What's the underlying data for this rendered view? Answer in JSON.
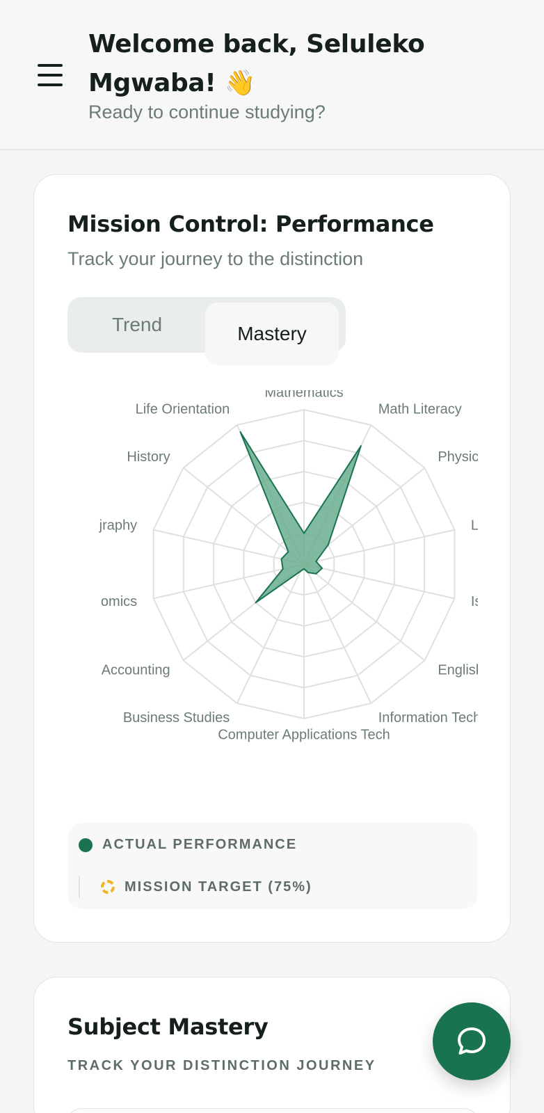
{
  "header": {
    "welcome": "Welcome back, Seluleko Mgwaba!",
    "wave": "👋",
    "subtitle": "Ready to continue studying?"
  },
  "performance_card": {
    "title": "Mission Control: Performance",
    "subtitle": "Track your journey to the distinction",
    "tabs": [
      {
        "label": "Trend",
        "selected": false
      },
      {
        "label": "Mastery",
        "selected": true
      }
    ],
    "legend": {
      "actual": "ACTUAL PERFORMANCE",
      "target": "MISSION TARGET (75%)"
    }
  },
  "chart_data": {
    "type": "radar",
    "categories": [
      "Mathematics",
      "Math Literacy",
      "Physical Sc",
      "Life Sc",
      "IsiZulu",
      "English Hor",
      "Information Technol",
      "Computer Applications Tech",
      "Business Studies",
      "Accounting",
      "omics",
      "jraphy",
      "History",
      "Life Orientation"
    ],
    "rlim": [
      0,
      100
    ],
    "rings": 5,
    "series": [
      {
        "values": [
          20,
          85,
          20,
          8,
          12,
          10,
          6,
          3,
          5,
          40,
          14,
          15,
          13,
          95
        ],
        "color": "#1a7350",
        "fill": "#6aae8f"
      }
    ],
    "grid_color": "#dde1df"
  },
  "mastery_card": {
    "title": "Subject Mastery",
    "subtitle": "TRACK YOUR DISTINCTION JOURNEY"
  },
  "icons": {
    "menu": "hamburger-menu-icon",
    "chat": "chat-bubble-icon"
  },
  "colors": {
    "accent": "#1a7350",
    "target": "#f0b429"
  }
}
